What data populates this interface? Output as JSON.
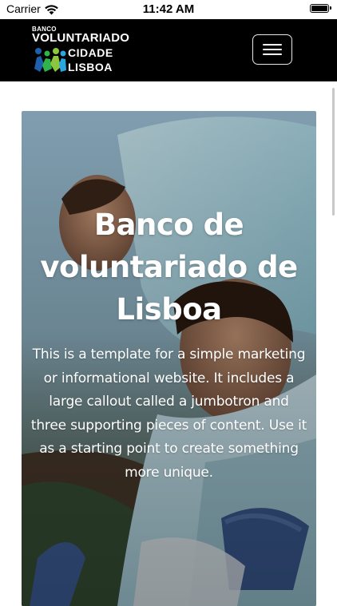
{
  "status_bar": {
    "carrier": "Carrier",
    "time": "11:42 AM",
    "icons": [
      "wifi-icon",
      "battery-icon"
    ]
  },
  "navbar": {
    "background": "#000000",
    "brand": {
      "small": "BANCO",
      "big": "VOLUNTARIADO",
      "line1": "CIDADE",
      "line2": "LISBOA",
      "mark_icon": "volunteer-figures-logo",
      "mark_colors": [
        "#1e5fae",
        "#2fb34a",
        "#8cc63f",
        "#29a8e0"
      ]
    },
    "menu_icon": "hamburger-menu-icon"
  },
  "jumbotron": {
    "title": "Banco de voluntariado de Lisboa",
    "lead": "This is a template for a simple marketing or informational website. It includes a large callout called a jumbotron and three supporting pieces of content. Use it as a starting point to create something more unique.",
    "background_image": "volunteers-photo"
  }
}
